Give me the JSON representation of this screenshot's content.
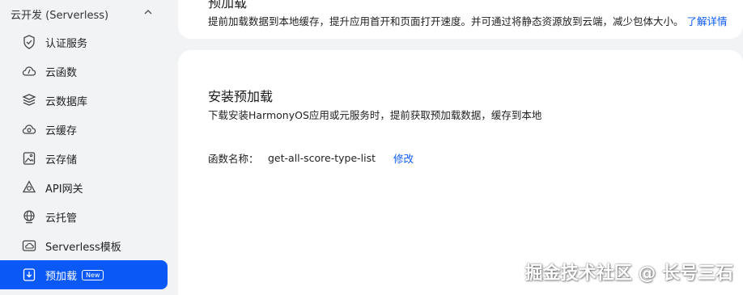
{
  "sidebar": {
    "group": {
      "label": "云开发 (Serverless)"
    },
    "items": [
      {
        "label": "认证服务",
        "icon": "shield-check-icon"
      },
      {
        "label": "云函数",
        "icon": "cloud-function-icon"
      },
      {
        "label": "云数据库",
        "icon": "database-icon"
      },
      {
        "label": "云缓存",
        "icon": "cloud-cache-icon"
      },
      {
        "label": "云存储",
        "icon": "image-storage-icon"
      },
      {
        "label": "API网关",
        "icon": "api-gateway-icon"
      },
      {
        "label": "云托管",
        "icon": "globe-hosting-icon"
      },
      {
        "label": "Serverless模板",
        "icon": "cloud-template-icon"
      },
      {
        "label": "预加载",
        "icon": "download-icon",
        "badge": "New",
        "active": true
      }
    ]
  },
  "top_card": {
    "title": "预加载",
    "description": "提前加载数据到本地缓存，提升应用首开和页面打开速度。并可通过将静态资源放到云端，减少包体大小。",
    "link": "了解详情"
  },
  "main_card": {
    "section_title": "安装预加载",
    "section_desc": "下载安装HarmonyOS应用或元服务时，提前获取预加载数据，缓存到本地",
    "function_label": "函数名称：",
    "function_value": "get-all-score-type-list",
    "edit_label": "修改"
  },
  "watermark": "掘金技术社区 @ 长号三石",
  "colors": {
    "accent": "#0a59f7",
    "sidebar_bg": "#f1f3f5",
    "card_bg": "#ffffff"
  }
}
